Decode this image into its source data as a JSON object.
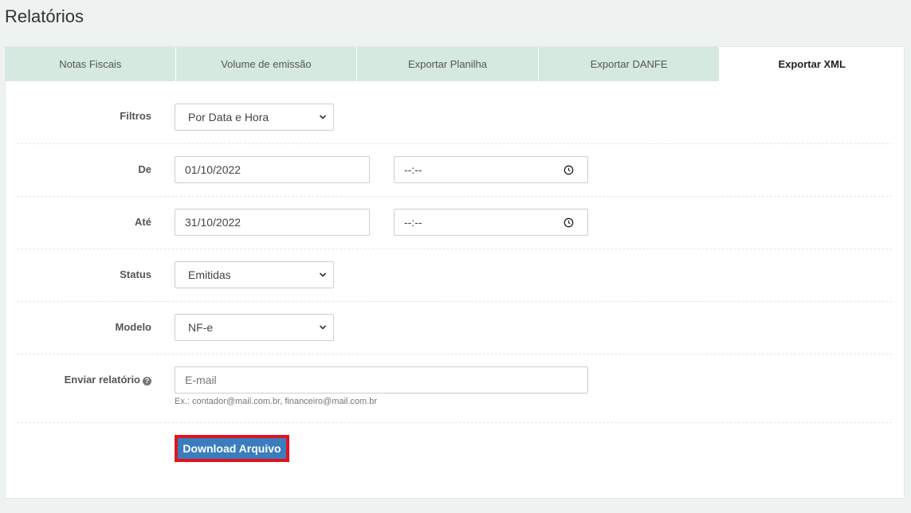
{
  "page": {
    "title": "Relatórios"
  },
  "tabs": [
    {
      "label": "Notas Fiscais"
    },
    {
      "label": "Volume de emissão"
    },
    {
      "label": "Exportar Planilha"
    },
    {
      "label": "Exportar DANFE"
    },
    {
      "label": "Exportar XML",
      "active": true
    }
  ],
  "form": {
    "filtros": {
      "label": "Filtros",
      "value": "Por Data e Hora"
    },
    "de": {
      "label": "De",
      "date": "01/10/2022",
      "time": "--:--"
    },
    "ate": {
      "label": "Até",
      "date": "31/10/2022",
      "time": "--:--"
    },
    "status": {
      "label": "Status",
      "value": "Emitidas"
    },
    "modelo": {
      "label": "Modelo",
      "value": "NF-e"
    },
    "enviar": {
      "label": "Enviar relatório",
      "help_icon": "question-circle-icon",
      "placeholder": "E-mail",
      "hint": "Ex.: contador@mail.com.br, financeiro@mail.com.br"
    },
    "download_label": "Download Arquivo"
  },
  "colors": {
    "tab_bg": "#d6e9e1",
    "button_bg": "#3a7dbf",
    "highlight_border": "#e0141e"
  }
}
